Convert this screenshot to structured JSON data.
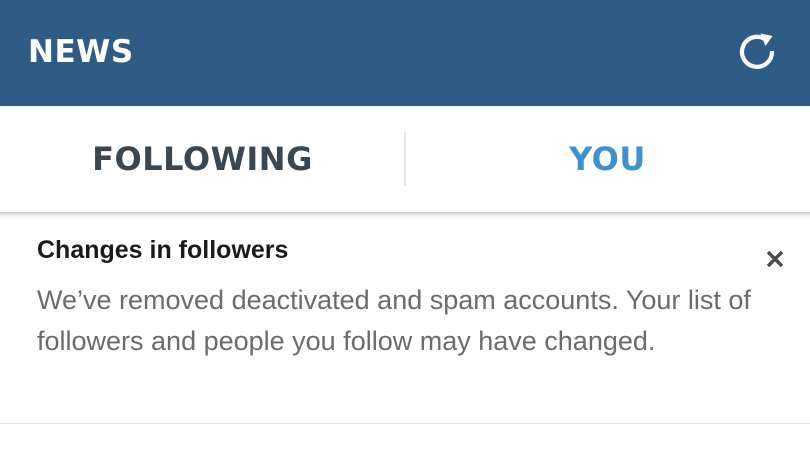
{
  "header": {
    "title": "NEWS",
    "background_color": "#2f5b87",
    "refresh_icon": "refresh-icon"
  },
  "tabs": [
    {
      "label": "FOLLOWING",
      "active": false,
      "color": "#3a4650"
    },
    {
      "label": "YOU",
      "active": true,
      "color": "#4092cf"
    }
  ],
  "notice": {
    "title": "Changes in followers",
    "body": "We’ve removed deactivated and spam accounts. Your list of followers and people you follow may have changed.",
    "close_icon": "close-icon"
  }
}
